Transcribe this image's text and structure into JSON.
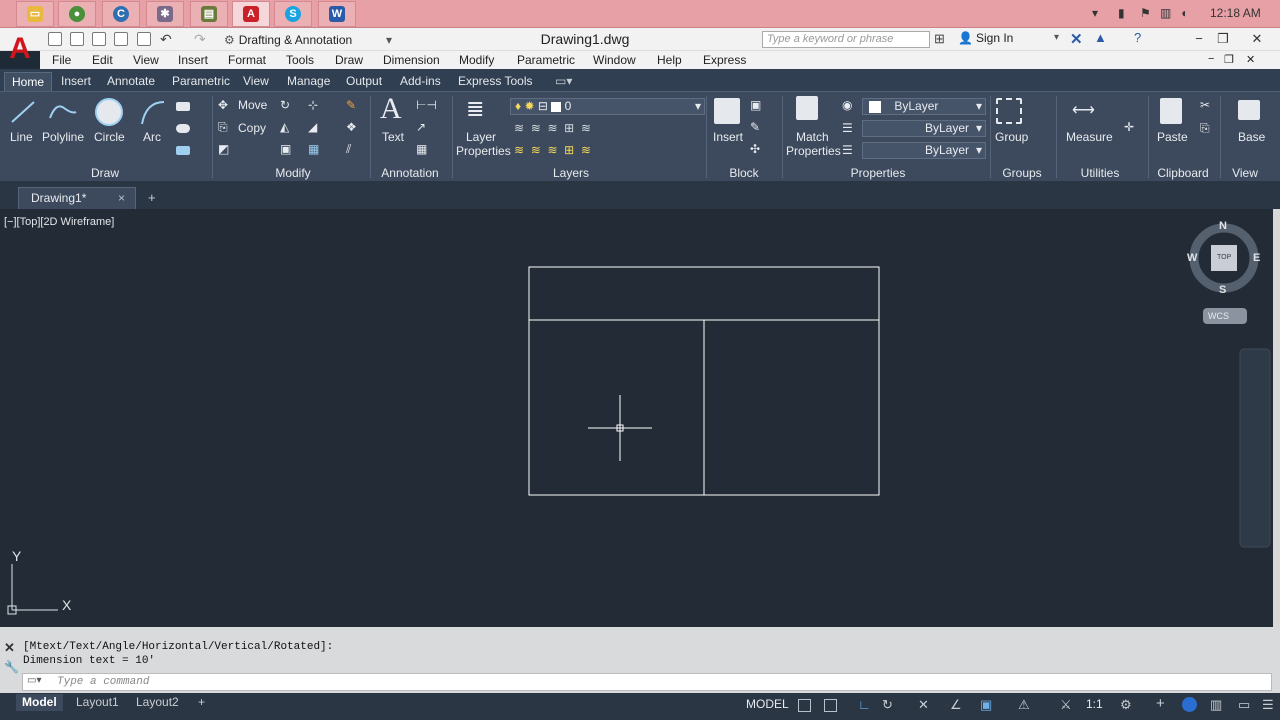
{
  "taskbar": {
    "time": "12:18 AM",
    "apps": [
      "file-explorer-icon",
      "chrome-icon",
      "app-icon",
      "network-icon",
      "app-icon-2",
      "autocad-icon",
      "skype-icon",
      "word-icon"
    ]
  },
  "titlebar": {
    "workspace": "Drafting & Annotation",
    "document": "Drawing1.dwg",
    "search_placeholder": "Type a keyword or phrase",
    "sign_in": "Sign In"
  },
  "menubar": {
    "items": [
      "File",
      "Edit",
      "View",
      "Insert",
      "Format",
      "Tools",
      "Draw",
      "Dimension",
      "Modify",
      "Parametric",
      "Window",
      "Help",
      "Express"
    ]
  },
  "ribbon": {
    "tabs": [
      "Home",
      "Insert",
      "Annotate",
      "Parametric",
      "View",
      "Manage",
      "Output",
      "Add-ins",
      "Express Tools"
    ],
    "draw": {
      "label": "Draw",
      "line": "Line",
      "polyline": "Polyline",
      "circle": "Circle",
      "arc": "Arc"
    },
    "modify": {
      "label": "Modify",
      "move": "Move",
      "copy": "Copy"
    },
    "annotation": {
      "label": "Annotation",
      "text": "Text"
    },
    "layers": {
      "label": "Layers",
      "layer_properties": "Layer Properties",
      "layer_properties_l1": "Layer",
      "layer_properties_l2": "Properties",
      "current_layer": "0"
    },
    "block": {
      "label": "Block",
      "insert": "Insert"
    },
    "properties": {
      "label": "Properties",
      "match_l1": "Match",
      "match_l2": "Properties",
      "color": "ByLayer",
      "linetype": "ByLayer",
      "lineweight": "ByLayer"
    },
    "groups": {
      "label": "Groups",
      "group": "Group"
    },
    "utilities": {
      "label": "Utilities",
      "measure": "Measure"
    },
    "clipboard": {
      "label": "Clipboard",
      "paste": "Paste"
    },
    "view": {
      "label": "View",
      "base": "Base"
    }
  },
  "filetabs": {
    "doc": "Drawing1*",
    "close": "×",
    "add": "+"
  },
  "viewport": {
    "label": "[−][Top][2D Wireframe]",
    "compass": {
      "n": "N",
      "s": "S",
      "e": "E",
      "w": "W",
      "top": "TOP",
      "wcs": "WCS"
    },
    "ucs": {
      "x": "X",
      "y": "Y"
    }
  },
  "command": {
    "history": [
      "[Mtext/Text/Angle/Horizontal/Vertical/Rotated]:",
      "Dimension text = 10'"
    ],
    "placeholder": "Type a command"
  },
  "status": {
    "tabs": [
      "Model",
      "Layout1",
      "Layout2"
    ],
    "model": "MODEL",
    "scale": "1:1"
  },
  "colors": {
    "accent": "#d0161d",
    "viewport": "#222b36",
    "ribbon": "#3d4a5d"
  }
}
